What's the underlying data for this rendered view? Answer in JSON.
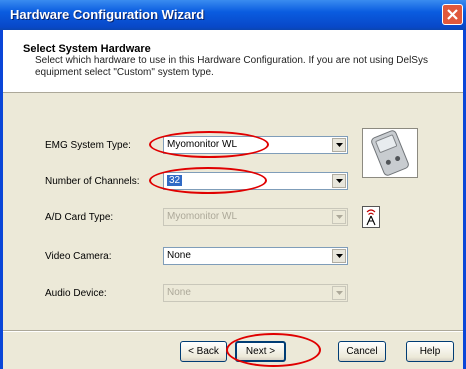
{
  "window": {
    "title": "Hardware Configuration Wizard"
  },
  "header": {
    "heading": "Select System Hardware",
    "description": "Select which hardware to use in this Hardware Configuration. If you are not using DelSys equipment select \"Custom\" system type."
  },
  "form": {
    "emg_label": "EMG System Type:",
    "emg_value": "Myomonitor WL",
    "channels_label": "Number of Channels:",
    "channels_value": "32",
    "ad_label": "A/D Card Type:",
    "ad_value": "Myomonitor WL",
    "video_label": "Video Camera:",
    "video_value": "None",
    "audio_label": "Audio Device:",
    "audio_value": "None"
  },
  "buttons": {
    "back": "< Back",
    "next": "Next >",
    "cancel": "Cancel",
    "help": "Help"
  },
  "colors": {
    "highlight": "#e00000",
    "titlebar": "#0a5ce0"
  }
}
